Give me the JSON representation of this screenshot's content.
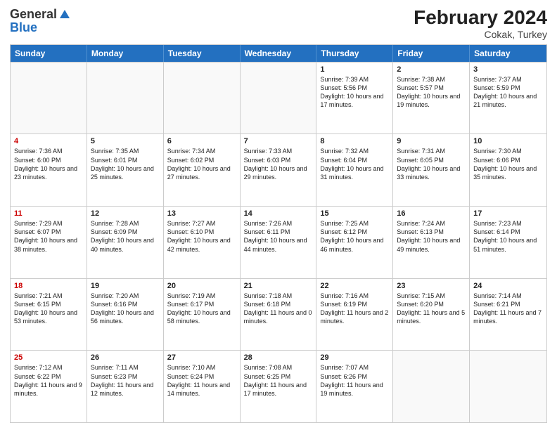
{
  "header": {
    "logo_general": "General",
    "logo_blue": "Blue",
    "title": "February 2024",
    "location": "Cokak, Turkey"
  },
  "days_of_week": [
    "Sunday",
    "Monday",
    "Tuesday",
    "Wednesday",
    "Thursday",
    "Friday",
    "Saturday"
  ],
  "weeks": [
    [
      {
        "day": "",
        "info": ""
      },
      {
        "day": "",
        "info": ""
      },
      {
        "day": "",
        "info": ""
      },
      {
        "day": "",
        "info": ""
      },
      {
        "day": "1",
        "info": "Sunrise: 7:39 AM\nSunset: 5:56 PM\nDaylight: 10 hours and 17 minutes."
      },
      {
        "day": "2",
        "info": "Sunrise: 7:38 AM\nSunset: 5:57 PM\nDaylight: 10 hours and 19 minutes."
      },
      {
        "day": "3",
        "info": "Sunrise: 7:37 AM\nSunset: 5:59 PM\nDaylight: 10 hours and 21 minutes."
      }
    ],
    [
      {
        "day": "4",
        "info": "Sunrise: 7:36 AM\nSunset: 6:00 PM\nDaylight: 10 hours and 23 minutes."
      },
      {
        "day": "5",
        "info": "Sunrise: 7:35 AM\nSunset: 6:01 PM\nDaylight: 10 hours and 25 minutes."
      },
      {
        "day": "6",
        "info": "Sunrise: 7:34 AM\nSunset: 6:02 PM\nDaylight: 10 hours and 27 minutes."
      },
      {
        "day": "7",
        "info": "Sunrise: 7:33 AM\nSunset: 6:03 PM\nDaylight: 10 hours and 29 minutes."
      },
      {
        "day": "8",
        "info": "Sunrise: 7:32 AM\nSunset: 6:04 PM\nDaylight: 10 hours and 31 minutes."
      },
      {
        "day": "9",
        "info": "Sunrise: 7:31 AM\nSunset: 6:05 PM\nDaylight: 10 hours and 33 minutes."
      },
      {
        "day": "10",
        "info": "Sunrise: 7:30 AM\nSunset: 6:06 PM\nDaylight: 10 hours and 35 minutes."
      }
    ],
    [
      {
        "day": "11",
        "info": "Sunrise: 7:29 AM\nSunset: 6:07 PM\nDaylight: 10 hours and 38 minutes."
      },
      {
        "day": "12",
        "info": "Sunrise: 7:28 AM\nSunset: 6:09 PM\nDaylight: 10 hours and 40 minutes."
      },
      {
        "day": "13",
        "info": "Sunrise: 7:27 AM\nSunset: 6:10 PM\nDaylight: 10 hours and 42 minutes."
      },
      {
        "day": "14",
        "info": "Sunrise: 7:26 AM\nSunset: 6:11 PM\nDaylight: 10 hours and 44 minutes."
      },
      {
        "day": "15",
        "info": "Sunrise: 7:25 AM\nSunset: 6:12 PM\nDaylight: 10 hours and 46 minutes."
      },
      {
        "day": "16",
        "info": "Sunrise: 7:24 AM\nSunset: 6:13 PM\nDaylight: 10 hours and 49 minutes."
      },
      {
        "day": "17",
        "info": "Sunrise: 7:23 AM\nSunset: 6:14 PM\nDaylight: 10 hours and 51 minutes."
      }
    ],
    [
      {
        "day": "18",
        "info": "Sunrise: 7:21 AM\nSunset: 6:15 PM\nDaylight: 10 hours and 53 minutes."
      },
      {
        "day": "19",
        "info": "Sunrise: 7:20 AM\nSunset: 6:16 PM\nDaylight: 10 hours and 56 minutes."
      },
      {
        "day": "20",
        "info": "Sunrise: 7:19 AM\nSunset: 6:17 PM\nDaylight: 10 hours and 58 minutes."
      },
      {
        "day": "21",
        "info": "Sunrise: 7:18 AM\nSunset: 6:18 PM\nDaylight: 11 hours and 0 minutes."
      },
      {
        "day": "22",
        "info": "Sunrise: 7:16 AM\nSunset: 6:19 PM\nDaylight: 11 hours and 2 minutes."
      },
      {
        "day": "23",
        "info": "Sunrise: 7:15 AM\nSunset: 6:20 PM\nDaylight: 11 hours and 5 minutes."
      },
      {
        "day": "24",
        "info": "Sunrise: 7:14 AM\nSunset: 6:21 PM\nDaylight: 11 hours and 7 minutes."
      }
    ],
    [
      {
        "day": "25",
        "info": "Sunrise: 7:12 AM\nSunset: 6:22 PM\nDaylight: 11 hours and 9 minutes."
      },
      {
        "day": "26",
        "info": "Sunrise: 7:11 AM\nSunset: 6:23 PM\nDaylight: 11 hours and 12 minutes."
      },
      {
        "day": "27",
        "info": "Sunrise: 7:10 AM\nSunset: 6:24 PM\nDaylight: 11 hours and 14 minutes."
      },
      {
        "day": "28",
        "info": "Sunrise: 7:08 AM\nSunset: 6:25 PM\nDaylight: 11 hours and 17 minutes."
      },
      {
        "day": "29",
        "info": "Sunrise: 7:07 AM\nSunset: 6:26 PM\nDaylight: 11 hours and 19 minutes."
      },
      {
        "day": "",
        "info": ""
      },
      {
        "day": "",
        "info": ""
      }
    ]
  ]
}
